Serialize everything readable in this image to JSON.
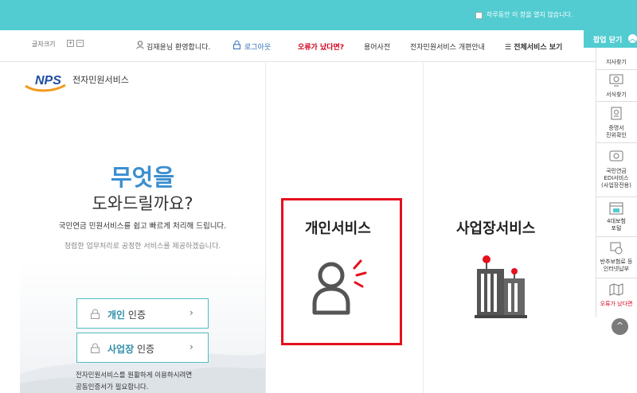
{
  "banner": {
    "checkbox_label": "하루동안 이 창을 열지 않습니다."
  },
  "header": {
    "font_size_label": "글자크기",
    "font_plus": "+",
    "font_minus": "−",
    "welcome": "김재윤님 환영합니다.",
    "logout": "로그아웃",
    "error_link": "오류가 났다면?",
    "glossary": "용어사전",
    "reorg_guide": "전자민원서비스 개편안내",
    "all_services": "전체서비스 보기"
  },
  "popup_close": {
    "label": "팝업 닫기",
    "icon": "chevron-up-icon"
  },
  "hero": {
    "logo_text": "NPS",
    "site_title": "전자민원서비스",
    "line1": "무엇을",
    "line2": "도와드릴까요?",
    "line3": "국민연금 민원서비스를 쉽고 빠르게 처리해 드립니다.",
    "line4": "청렴한 업무처리로 공정한 서비스를 제공하겠습니다."
  },
  "auth": {
    "personal_bold": "개인",
    "personal_rest": " 인증",
    "business_bold": "사업장",
    "business_rest": " 인증",
    "arrow": "›",
    "note_line1": "전자민원서비스를 원활하게 이용하시려면",
    "note_line2": "공동인증서가 필요합니다."
  },
  "services": {
    "personal": {
      "title": "개인서비스",
      "icon": "person-icon"
    },
    "business": {
      "title": "사업장서비스",
      "icon": "building-icon"
    }
  },
  "quick_menu": [
    {
      "label": "지사찾기",
      "icon": "map-icon"
    },
    {
      "label": "서식찾기",
      "icon": "monitor-search-icon"
    },
    {
      "label": "증명서\n진위확인",
      "icon": "certificate-icon"
    },
    {
      "label": "국민연금\nEDI서비스\n(사업장전용)",
      "icon": "edi-icon"
    },
    {
      "label": "4대보험\n포털",
      "icon": "portal-icon"
    },
    {
      "label": "반추보험료 등\n인터넷납부",
      "icon": "payment-icon"
    },
    {
      "label": "오류가 났다면",
      "icon": "map-error-icon"
    }
  ],
  "scroll_top": "^",
  "colors": {
    "accent": "#52ccd1",
    "brand_blue": "#3b8fd0",
    "alert_red": "#e4101e"
  }
}
